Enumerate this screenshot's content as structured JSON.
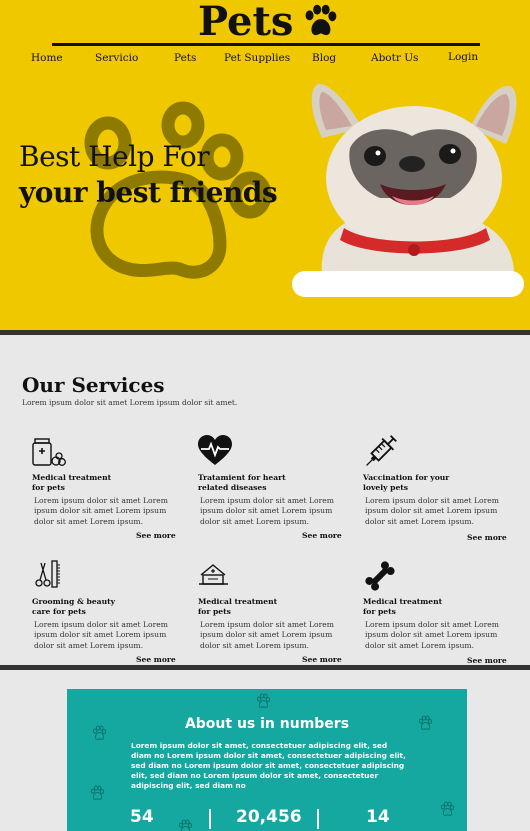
{
  "header": {
    "logo": "Pets",
    "nav": [
      "Home",
      "Servicio",
      "Pets",
      "Pet Supplies",
      "Blog",
      "Abotr Us",
      "Login"
    ]
  },
  "hero": {
    "title_line1": "Best Help For",
    "title_line2": "your best friends",
    "input_value": ""
  },
  "services": {
    "title": "Our Services",
    "subtitle": "Lorem ipsum dolor sit amet Lorem ipsum dolor sit amet.",
    "items": [
      {
        "icon": "medicine-icon",
        "title_1": "Medical treatment",
        "title_2": "for pets",
        "desc": "Lorem ipsum dolor sit amet Lorem ipsum dolor sit amet Lorem ipsum dolor sit amet Lorem ipsum.",
        "more": "See more"
      },
      {
        "icon": "heart-pulse-icon",
        "title_1": "Tratamient for heart",
        "title_2": "related diseases",
        "desc": "Lorem ipsum dolor sit amet Lorem ipsum dolor sit amet Lorem ipsum dolor sit amet Lorem ipsum.",
        "more": "See more"
      },
      {
        "icon": "syringe-icon",
        "title_1": "Vaccination for your",
        "title_2": "lovely pets",
        "desc": "Lorem ipsum dolor sit amet Lorem ipsum dolor sit amet Lorem ipsum dolor sit amet Lorem ipsum.",
        "more": "See more"
      },
      {
        "icon": "grooming-icon",
        "title_1": "Grooming & beauty",
        "title_2": "care for pets",
        "desc": "Lorem ipsum dolor sit amet Lorem ipsum dolor sit amet Lorem ipsum dolor sit amet Lorem ipsum.",
        "more": "See more"
      },
      {
        "icon": "pet-house-icon",
        "title_1": "Medical treatment",
        "title_2": "for pets",
        "desc": "Lorem ipsum dolor sit amet Lorem ipsum dolor sit amet Lorem ipsum dolor sit amet Lorem ipsum.",
        "more": "See more"
      },
      {
        "icon": "bone-icon",
        "title_1": "Medical treatment",
        "title_2": "for pets",
        "desc": "Lorem ipsum dolor sit amet Lorem ipsum dolor sit amet Lorem ipsum dolor sit amet Lorem ipsum.",
        "more": "See more"
      }
    ]
  },
  "about": {
    "title": "About us in numbers",
    "text": "Lorem ipsum dolor sit amet, consectetuer adipiscing elit, sed diam no Lorem ipsum dolor sit amet, consectetuer adipiscing elit, sed diam no Lorem ipsum dolor sit amet, consectetuer adipiscing elit, sed diam no Lorem ipsum dolor sit amet, consectetuer adipiscing elit, sed diam no",
    "numbers": [
      "54",
      "20,456",
      "14"
    ]
  },
  "colors": {
    "hero_bg": "#f0c800",
    "about_bg": "#14a8a0",
    "paw_outline": "#8f7a00"
  }
}
